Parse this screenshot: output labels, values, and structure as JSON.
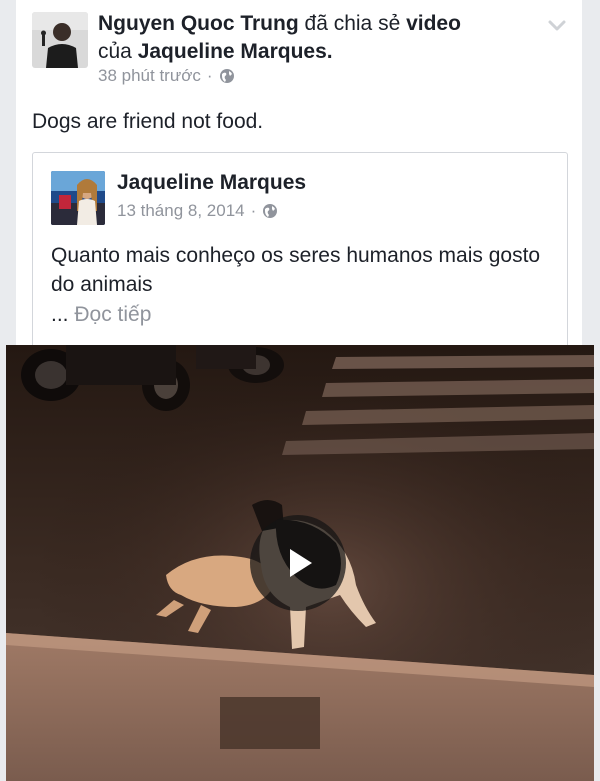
{
  "post": {
    "author": "Nguyen Quoc Trung",
    "action_text": "đã chia sẻ",
    "object_text": "video",
    "of_text": "của",
    "source_name": "Jaqueline Marques.",
    "timestamp": "38 phút trước",
    "separator": "·",
    "status_text": "Dogs are friend not food."
  },
  "shared": {
    "author": "Jaqueline Marques",
    "timestamp": "13 tháng 8, 2014",
    "separator": "·",
    "text": "Quanto mais conheço os seres humanos mais gosto do animais",
    "ellipsis": "...",
    "read_more": "Đọc tiếp"
  },
  "icons": {
    "privacy": "globe-icon",
    "options": "chevron-down-icon",
    "video_play": "play-icon"
  },
  "colors": {
    "text_primary": "#1d2129",
    "text_meta": "#90949c",
    "card_border": "#d3d6db"
  }
}
